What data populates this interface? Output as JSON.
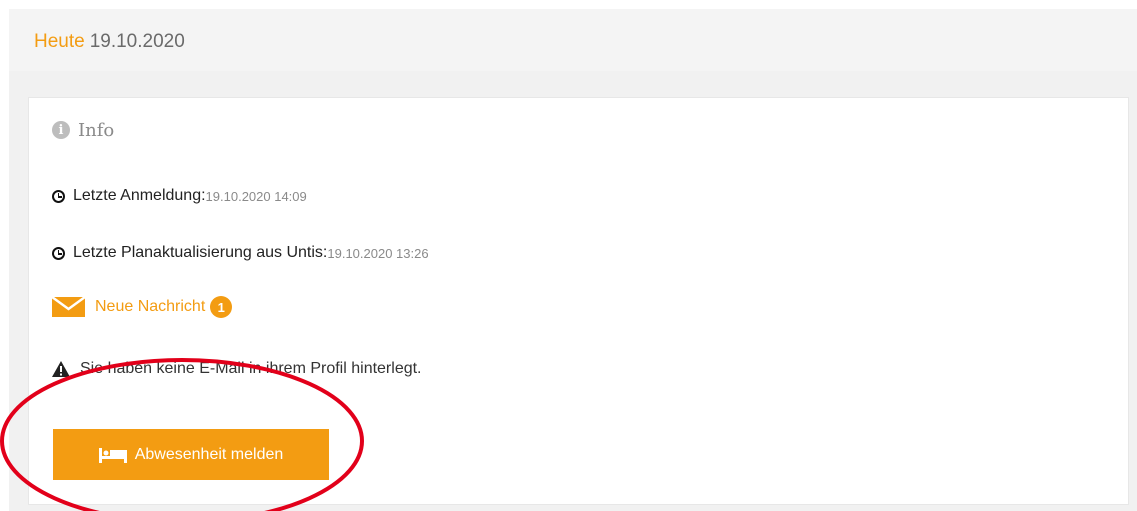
{
  "header": {
    "label": "Heute",
    "date": "19.10.2020"
  },
  "info": {
    "title": "Info",
    "icon": "info-circle-icon"
  },
  "last_login": {
    "label": "Letzte Anmeldung:",
    "value": "19.10.2020 14:09"
  },
  "last_update": {
    "label": "Letzte Planaktualisierung aus Untis:",
    "value": "19.10.2020 13:26"
  },
  "messages": {
    "label": "Neue Nachricht",
    "count": "1"
  },
  "warning": {
    "text": "Sie haben keine E-Mail in ihrem Profil hinterlegt."
  },
  "absence_button": {
    "label": "Abwesenheit melden"
  },
  "colors": {
    "accent": "#f39c12",
    "annotation": "#e2001a",
    "background": "#f4f4f4"
  }
}
